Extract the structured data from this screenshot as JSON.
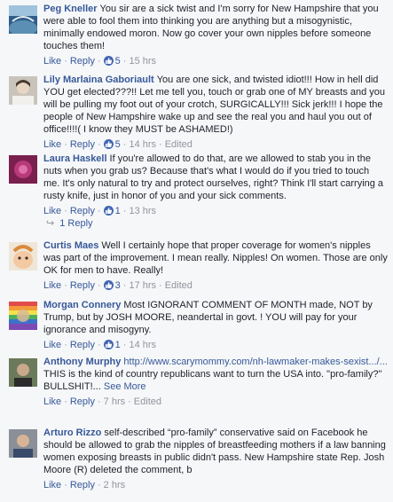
{
  "comments": [
    {
      "author": "Peg Kneller",
      "text": "You sir are a sick twist and I'm sorry for New Hampshire that you were able to fool them into thinking you are anything but a misogynistic, minimally endowed moron. Now go cover your own nipples before someone touches them!",
      "like": "Like",
      "reply": "Reply",
      "likes": "5",
      "time": "15 hrs",
      "edited": ""
    },
    {
      "author": "Lily Marlaina Gaboriault",
      "text": "You are one sick, and twisted idiot!!! How in hell did YOU get elected???!! Let me tell you, touch or grab one of MY breasts and you will be pulling my foot out of your crotch, SURGICALLY!!! Sick jerk!!! I hope the people of New Hampshire wake up and see the real you and haul you out of office!!!!( I know they MUST be ASHAMED!)",
      "like": "Like",
      "reply": "Reply",
      "likes": "5",
      "time": "14 hrs",
      "edited": "Edited"
    },
    {
      "author": "Laura Haskell",
      "text": "If you're allowed to do that, are we allowed to stab you in the nuts when you grab us? Because that's what I would do if you tried to touch me. It's only natural to try and protect ourselves, right? Think I'll start carrying a rusty knife, just in honor of you and your sick comments.",
      "like": "Like",
      "reply": "Reply",
      "likes": "1",
      "time": "13 hrs",
      "edited": "",
      "replies": "1 Reply"
    },
    {
      "author": "Curtis Maes",
      "text": "Well I certainly hope that proper coverage for women's nipples was part of the improvement. I mean really. Nipples! On women. Those are only OK for men to have. Really!",
      "like": "Like",
      "reply": "Reply",
      "likes": "3",
      "time": "17 hrs",
      "edited": "Edited"
    },
    {
      "author": "Morgan Connery",
      "text": "Most IGNORANT COMMENT OF MONTH made, NOT by Trump, but by JOSH MOORE, neandertal in govt. ! YOU will pay for your ignorance and misogyny.",
      "like": "Like",
      "reply": "Reply",
      "likes": "1",
      "time": "14 hrs",
      "edited": ""
    },
    {
      "author": "Anthony Murphy",
      "link": "http://www.scarymommy.com/nh-lawmaker-makes-sexist.../...",
      "text": "THIS is the kind of country republicans want to turn the USA into. \"pro-family?\" BULLSHIT!...",
      "see_more": "See More",
      "like": "Like",
      "reply": "Reply",
      "likes": "",
      "time": "7 hrs",
      "edited": "Edited"
    },
    {
      "author": "Arturo Rizzo",
      "text": "self-described “pro-family” conservative said on Facebook he should be allowed to grab the nipples of breastfeeding mothers if a law banning women exposing breasts in public didn't pass. New Hampshire state Rep. Josh Moore (R) deleted the comment, b",
      "like": "Like",
      "reply": "Reply",
      "likes": "",
      "time": "2 hrs",
      "edited": ""
    }
  ],
  "colors": {
    "link": "#365899",
    "meta": "#90949c",
    "like_badge": "#4267b2"
  }
}
